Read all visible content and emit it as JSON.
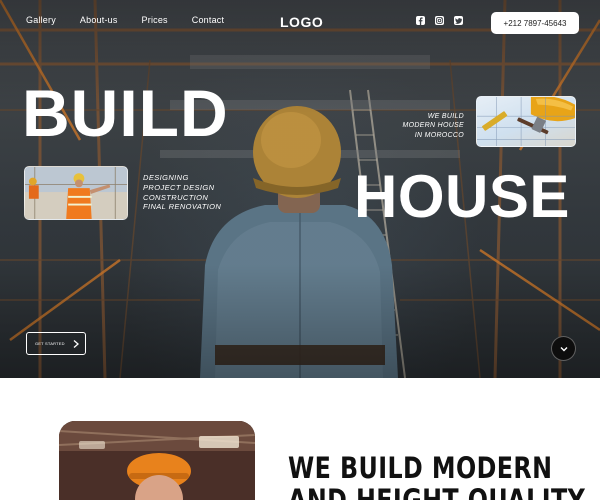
{
  "nav": {
    "items": [
      {
        "label": "Gallery"
      },
      {
        "label": "About-us"
      },
      {
        "label": "Prices"
      },
      {
        "label": "Contact"
      }
    ]
  },
  "brand": {
    "logo": "LOGO"
  },
  "social": [
    {
      "icon": "facebook-icon"
    },
    {
      "icon": "instagram-icon"
    },
    {
      "icon": "twitter-icon"
    }
  ],
  "contact": {
    "phone": "+212 7897-45643"
  },
  "hero": {
    "headline_top": "BUILD",
    "headline_bottom": "HOUSE",
    "tagline": [
      "WE BUILD",
      "MODERN HOUSE",
      "IN MOROCCO"
    ],
    "services": [
      "DESIGNING",
      "PROJECT DESIGN",
      "CONSTRUCTION",
      "FINAL RENOVATION"
    ],
    "cta_label": "GET STARTED",
    "scroll_icon": "chevron-down-icon"
  },
  "about": {
    "heading_lines": [
      "WE BUILD MODERN",
      "AND HEIGHT QUALITY"
    ]
  },
  "colors": {
    "hero_text": "#ffffff",
    "dark": "#0d0d0d",
    "heading": "#111111",
    "accent_orange": "#e0831c"
  }
}
